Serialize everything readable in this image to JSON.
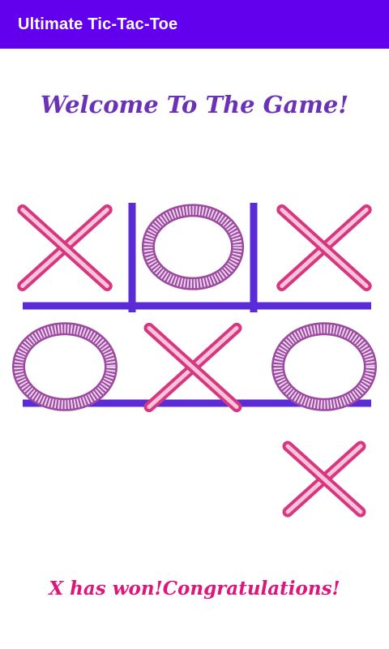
{
  "appbar": {
    "title": "Ultimate Tic-Tac-Toe",
    "color": "#6200ee"
  },
  "welcome_text": "Welcome To The Game!",
  "board": {
    "grid_color": "#5a2bd6",
    "x_color": "#d6377f",
    "o_color": "#9b4a9f",
    "cells": [
      "X",
      "O",
      "X",
      "O",
      "X",
      "O",
      "",
      "",
      "X"
    ]
  },
  "result_text": "X has won!Congratulations!"
}
